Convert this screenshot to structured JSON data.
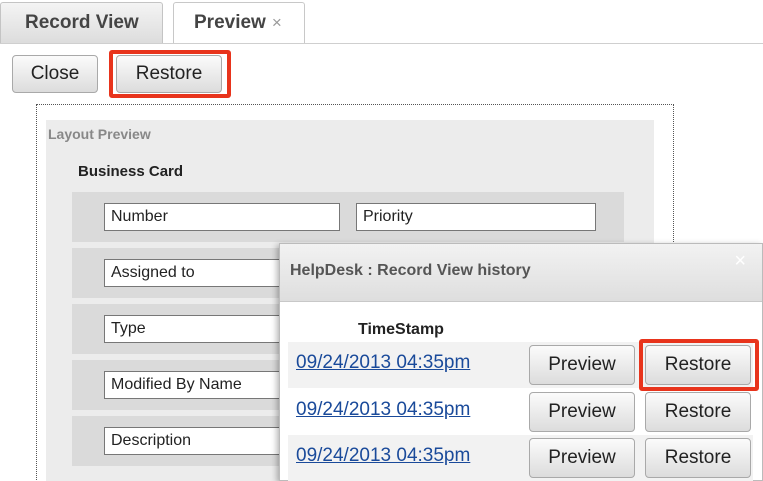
{
  "tabs": [
    {
      "label": "Record View"
    },
    {
      "label": "Preview",
      "close_glyph": "×"
    }
  ],
  "toolbar": {
    "close_label": "Close",
    "restore_label": "Restore"
  },
  "layout_preview": {
    "title": "Layout Preview",
    "panel_title": "Business Card",
    "fields": [
      {
        "left": "Number",
        "right": "Priority"
      },
      {
        "left": "Assigned to",
        "right": ""
      },
      {
        "left": "Type",
        "right": ""
      },
      {
        "left": "Modified By Name",
        "right": ""
      },
      {
        "left": "Description",
        "right": ""
      }
    ]
  },
  "history": {
    "title": "HelpDesk : Record View history",
    "close_glyph": "×",
    "column_header": "TimeStamp",
    "rows": [
      {
        "timestamp": "09/24/2013 04:35pm",
        "preview_label": "Preview",
        "restore_label": "Restore"
      },
      {
        "timestamp": "09/24/2013 04:35pm",
        "preview_label": "Preview",
        "restore_label": "Restore"
      },
      {
        "timestamp": "09/24/2013 04:35pm",
        "preview_label": "Preview",
        "restore_label": "Restore"
      }
    ]
  },
  "colors": {
    "highlight": "#e8341c",
    "link": "#1a4a9a"
  }
}
